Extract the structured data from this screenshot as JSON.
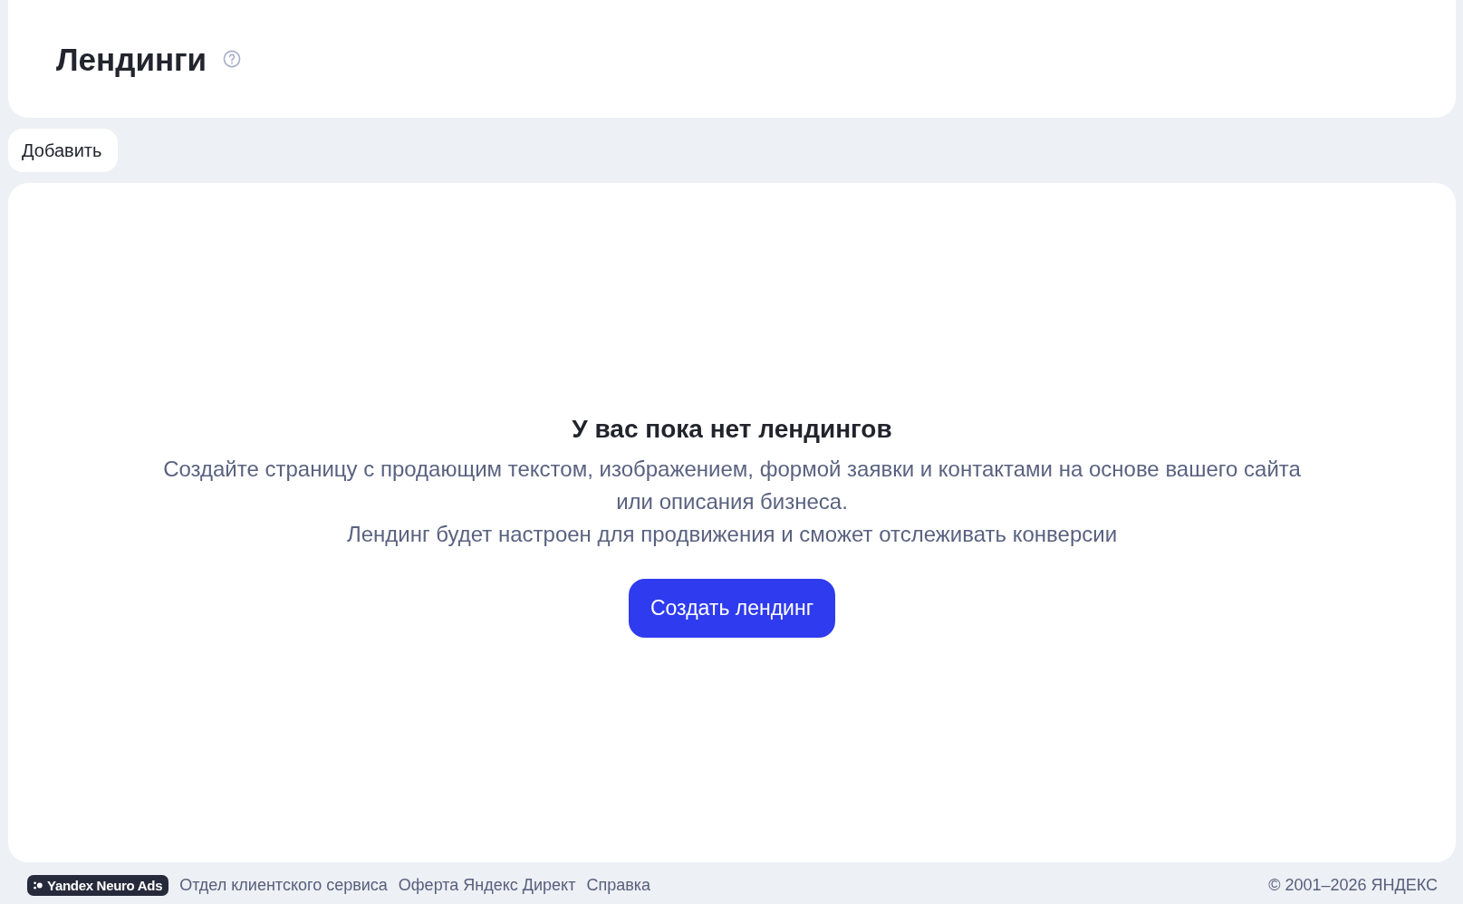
{
  "header": {
    "title": "Лендинги"
  },
  "toolbar": {
    "add_button": "Добавить"
  },
  "empty_state": {
    "title": "У вас пока нет лендингов",
    "description": [
      "Создайте страницу с продающим текстом, изображением, формой заявки и контактами на основе вашего сайта или описания бизнеса.",
      "Лендинг будет настроен для продвижения и сможет отслеживать конверсии"
    ],
    "button": "Создать лендинг"
  },
  "footer": {
    "badge": "Yandex Neuro Ads",
    "links": [
      "Отдел клиентского сервиса",
      "Оферта Яндекс Директ",
      "Справка"
    ],
    "copyright": "© 2001–2026 ЯНДЕКС"
  }
}
